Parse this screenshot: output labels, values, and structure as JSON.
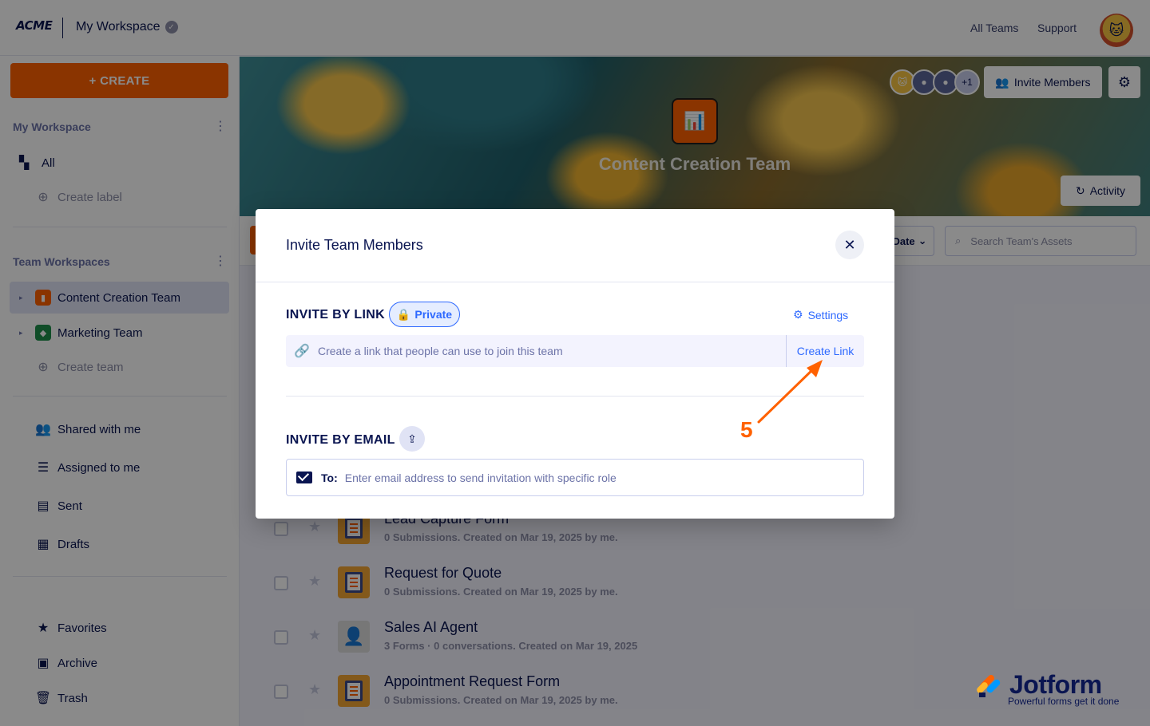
{
  "header": {
    "logo": "ACME",
    "workspace_title": "My Workspace",
    "links": [
      "All Teams",
      "Support"
    ]
  },
  "sidebar": {
    "create_label": "+ CREATE",
    "my_workspace_heading": "My Workspace",
    "all_label": "All",
    "create_label_item": "Create label",
    "team_workspaces_heading": "Team Workspaces",
    "teams": [
      {
        "label": "Content Creation Team",
        "active": true,
        "color": "#ff6100"
      },
      {
        "label": "Marketing Team",
        "active": false,
        "color": "#1f8f4a"
      }
    ],
    "create_team": "Create team",
    "nav": [
      "Shared with me",
      "Assigned to me",
      "Sent",
      "Drafts"
    ],
    "bottom_nav": [
      "Favorites",
      "Archive",
      "Trash"
    ]
  },
  "banner": {
    "team_name": "Content Creation Team",
    "member_overflow": "+1",
    "invite_members": "Invite Members",
    "activity": "Activity"
  },
  "toolbar": {
    "sort_label": "Date",
    "search_placeholder": "Search Team's Assets"
  },
  "assets": [
    {
      "title": "Lead Capture Form",
      "meta": "0 Submissions. Created on Mar 19, 2025 by me.",
      "kind": "form"
    },
    {
      "title": "Request for Quote",
      "meta": "0 Submissions. Created on Mar 19, 2025 by me.",
      "kind": "form"
    },
    {
      "title": "Sales AI Agent",
      "meta": "3 Forms · 0 conversations. Created on Mar 19, 2025",
      "kind": "agent"
    },
    {
      "title": "Appointment Request Form",
      "meta": "0 Submissions. Created on Mar 19, 2025 by me.",
      "kind": "form"
    }
  ],
  "modal": {
    "title": "Invite Team Members",
    "invite_by_link": "INVITE BY LINK",
    "private_label": "Private",
    "settings_label": "Settings",
    "link_placeholder": "Create a link that people can use to join this team",
    "create_link": "Create Link",
    "invite_by_email": "INVITE BY EMAIL",
    "to_label": "To:",
    "email_placeholder": "Enter email address to send invitation with specific role"
  },
  "annotation": {
    "step": "5",
    "color": "#ff6100"
  },
  "watermark": {
    "brand": "Jotform",
    "tagline": "Powerful forms get it done"
  },
  "colors": {
    "accent": "#ff6100",
    "link": "#2e69ff",
    "navy": "#0a1551"
  }
}
